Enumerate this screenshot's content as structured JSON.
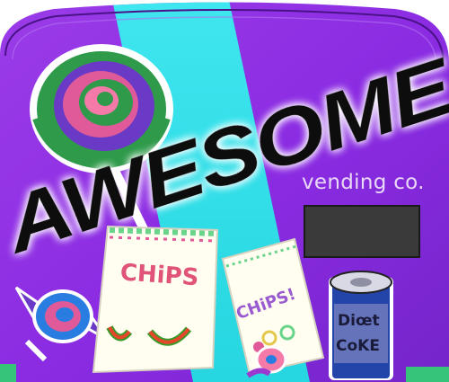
{
  "brand": {
    "title": "AWESOME",
    "subtitle": "vending co."
  },
  "drawings": {
    "chips_bag_left_label": "CHiPS",
    "chips_bag_right_label": "CHiPS!",
    "soda_can_label_line1": "Diœt",
    "soda_can_label_line2": "CoKE"
  },
  "colors": {
    "machine_purple": "#8a2be2",
    "machine_purple_dark": "#6a1fb0",
    "cyan_stripe": "#2de0ea",
    "title_fill": "#111111",
    "title_glow": "#ffffff",
    "display_panel": "#3a3a3a"
  }
}
